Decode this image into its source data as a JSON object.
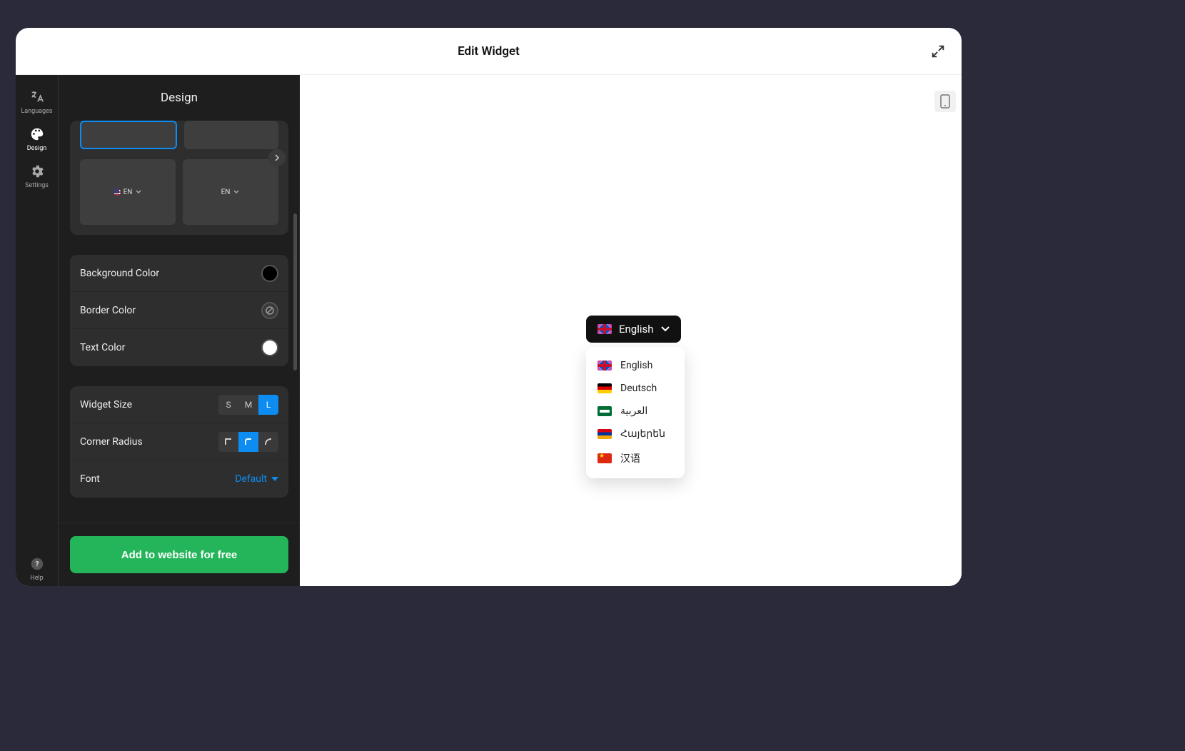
{
  "header": {
    "title": "Edit Widget"
  },
  "nav": {
    "languages": "Languages",
    "design": "Design",
    "settings": "Settings",
    "help": "Help"
  },
  "panel": {
    "title": "Design",
    "template3_label": "EN",
    "template4_label": "EN",
    "bg_color_label": "Background Color",
    "border_color_label": "Border Color",
    "text_color_label": "Text Color",
    "widget_size_label": "Widget Size",
    "sizes": {
      "s": "S",
      "m": "M",
      "l": "L",
      "selected": "L"
    },
    "corner_radius_label": "Corner Radius",
    "font_label": "Font",
    "font_value": "Default",
    "cta": "Add to website for free"
  },
  "widget": {
    "current": "English",
    "options": [
      {
        "name": "English",
        "flag": "uk"
      },
      {
        "name": "Deutsch",
        "flag": "de"
      },
      {
        "name": "العربية",
        "flag": "sa"
      },
      {
        "name": "Հայերեն",
        "flag": "am"
      },
      {
        "name": "汉语",
        "flag": "cn"
      }
    ]
  }
}
